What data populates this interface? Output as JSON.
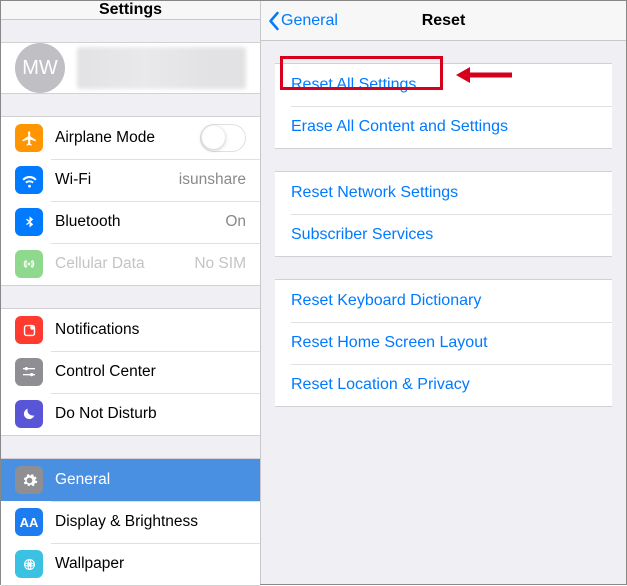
{
  "left": {
    "title": "Settings",
    "avatar_initials": "MW",
    "items1": [
      {
        "label": "Airplane Mode",
        "value": ""
      },
      {
        "label": "Wi-Fi",
        "value": "isunshare"
      },
      {
        "label": "Bluetooth",
        "value": "On"
      },
      {
        "label": "Cellular Data",
        "value": "No SIM"
      }
    ],
    "items2": [
      {
        "label": "Notifications"
      },
      {
        "label": "Control Center"
      },
      {
        "label": "Do Not Disturb"
      }
    ],
    "items3": [
      {
        "label": "General"
      },
      {
        "label": "Display & Brightness"
      },
      {
        "label": "Wallpaper"
      }
    ]
  },
  "right": {
    "back": "General",
    "title": "Reset",
    "g1": [
      {
        "label": "Reset All Settings"
      },
      {
        "label": "Erase All Content and Settings"
      }
    ],
    "g2": [
      {
        "label": "Reset Network Settings"
      },
      {
        "label": "Subscriber Services"
      }
    ],
    "g3": [
      {
        "label": "Reset Keyboard Dictionary"
      },
      {
        "label": "Reset Home Screen Layout"
      },
      {
        "label": "Reset Location & Privacy"
      }
    ]
  },
  "annotation": {
    "highlighted": "Reset All Settings"
  }
}
